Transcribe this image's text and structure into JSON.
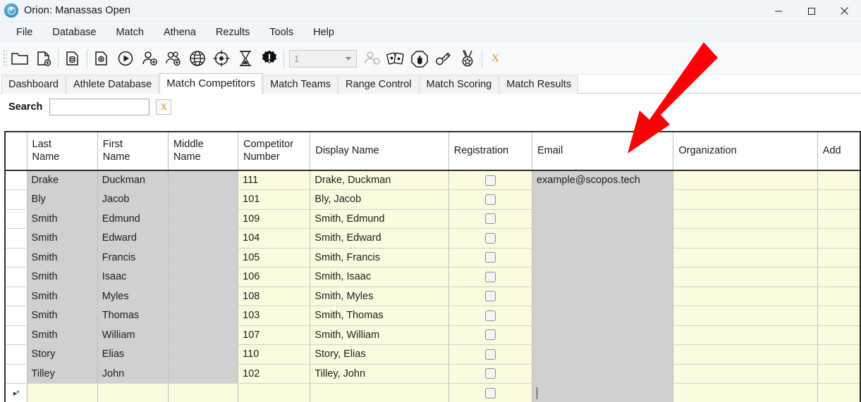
{
  "window": {
    "title": "Orion: Manassas Open",
    "logo_icon": "orion-logo-icon",
    "minimize_label": "Minimize",
    "maximize_label": "Maximize",
    "close_label": "Close"
  },
  "menubar": {
    "items": [
      {
        "label": "File"
      },
      {
        "label": "Database"
      },
      {
        "label": "Match"
      },
      {
        "label": "Athena"
      },
      {
        "label": "Rezults"
      },
      {
        "label": "Tools"
      },
      {
        "label": "Help"
      }
    ]
  },
  "toolbar": {
    "buttons": [
      {
        "icon": "open-folder-icon"
      },
      {
        "icon": "new-document-icon"
      },
      {
        "icon": "database-document-icon"
      },
      {
        "icon": "settings-document-icon"
      },
      {
        "icon": "play-circle-icon"
      },
      {
        "icon": "add-person-icon"
      },
      {
        "icon": "add-people-icon"
      },
      {
        "icon": "globe-icon"
      },
      {
        "icon": "target-icon"
      },
      {
        "icon": "hourglass-icon"
      },
      {
        "icon": "alert-badge-icon"
      }
    ],
    "relay_combo": {
      "value": "1",
      "icon": "chevron-down-icon"
    },
    "buttons2": [
      {
        "icon": "swap-person-icon"
      },
      {
        "icon": "score-cards-icon"
      },
      {
        "icon": "stop-hand-icon"
      },
      {
        "icon": "wrench-icon"
      },
      {
        "icon": "medal-icon"
      }
    ],
    "x_label": "X"
  },
  "tabs": {
    "items": [
      {
        "label": "Dashboard",
        "active": false
      },
      {
        "label": "Athlete Database",
        "active": false
      },
      {
        "label": "Match Competitors",
        "active": true
      },
      {
        "label": "Match Teams",
        "active": false
      },
      {
        "label": "Range Control",
        "active": false
      },
      {
        "label": "Match Scoring",
        "active": false
      },
      {
        "label": "Match Results",
        "active": false
      }
    ]
  },
  "search": {
    "label": "Search",
    "value": "",
    "placeholder": "",
    "clear_label": "X"
  },
  "grid": {
    "columns": [
      {
        "key": "sel",
        "label": ""
      },
      {
        "key": "last",
        "label": "Last\nName"
      },
      {
        "key": "first",
        "label": "First\nName"
      },
      {
        "key": "mid",
        "label": "Middle\nName"
      },
      {
        "key": "num",
        "label": "Competitor\nNumber"
      },
      {
        "key": "disp",
        "label": "Display Name"
      },
      {
        "key": "reg",
        "label": "Registration"
      },
      {
        "key": "email",
        "label": "Email"
      },
      {
        "key": "org",
        "label": "Organization"
      },
      {
        "key": "addr",
        "label": "Add"
      }
    ],
    "column_labels": {
      "last_l1": "Last",
      "last_l2": "Name",
      "first_l1": "First",
      "first_l2": "Name",
      "mid_l1": "Middle",
      "mid_l2": "Name",
      "num_l1": "Competitor",
      "num_l2": "Number",
      "disp": "Display Name",
      "reg": "Registration",
      "email": "Email",
      "org": "Organization",
      "addr": "Add"
    },
    "rows": [
      {
        "last": "Drake",
        "first": "Duckman",
        "mid": "",
        "num": "111",
        "disp": "Drake, Duckman",
        "checked": false,
        "email": "example@scopos.tech",
        "org": "",
        "addr": ""
      },
      {
        "last": "Bly",
        "first": "Jacob",
        "mid": "",
        "num": "101",
        "disp": "Bly, Jacob",
        "checked": false,
        "email": "",
        "org": "",
        "addr": ""
      },
      {
        "last": "Smith",
        "first": "Edmund",
        "mid": "",
        "num": "109",
        "disp": "Smith, Edmund",
        "checked": false,
        "email": "",
        "org": "",
        "addr": ""
      },
      {
        "last": "Smith",
        "first": "Edward",
        "mid": "",
        "num": "104",
        "disp": "Smith, Edward",
        "checked": false,
        "email": "",
        "org": "",
        "addr": ""
      },
      {
        "last": "Smith",
        "first": "Francis",
        "mid": "",
        "num": "105",
        "disp": "Smith, Francis",
        "checked": false,
        "email": "",
        "org": "",
        "addr": ""
      },
      {
        "last": "Smith",
        "first": "Isaac",
        "mid": "",
        "num": "106",
        "disp": "Smith, Isaac",
        "checked": false,
        "email": "",
        "org": "",
        "addr": ""
      },
      {
        "last": "Smith",
        "first": "Myles",
        "mid": "",
        "num": "108",
        "disp": "Smith, Myles",
        "checked": false,
        "email": "",
        "org": "",
        "addr": ""
      },
      {
        "last": "Smith",
        "first": "Thomas",
        "mid": "",
        "num": "103",
        "disp": "Smith, Thomas",
        "checked": false,
        "email": "",
        "org": "",
        "addr": ""
      },
      {
        "last": "Smith",
        "first": "William",
        "mid": "",
        "num": "107",
        "disp": "Smith, William",
        "checked": false,
        "email": "",
        "org": "",
        "addr": ""
      },
      {
        "last": "Story",
        "first": "Elias",
        "mid": "",
        "num": "110",
        "disp": "Story, Elias",
        "checked": false,
        "email": "",
        "org": "",
        "addr": ""
      },
      {
        "last": "Tilley",
        "first": "John",
        "mid": "",
        "num": "102",
        "disp": "Tilley, John",
        "checked": false,
        "email": "",
        "org": "",
        "addr": ""
      }
    ],
    "new_row": {
      "indicator": "▸*",
      "last": "",
      "first": "",
      "mid": "",
      "num": "",
      "disp": "",
      "checked": false,
      "email": "",
      "org": "",
      "addr": "",
      "email_focused": true
    }
  },
  "annotation": {
    "arrow_color": "#fb0007",
    "arrow_name": "red-pointer-arrow"
  },
  "colors": {
    "editable_cell": "#fcfbe0",
    "readonly_cell": "#d0d0d0",
    "accent_orange": "#d98c1e",
    "chrome": "#f2f5f7"
  }
}
